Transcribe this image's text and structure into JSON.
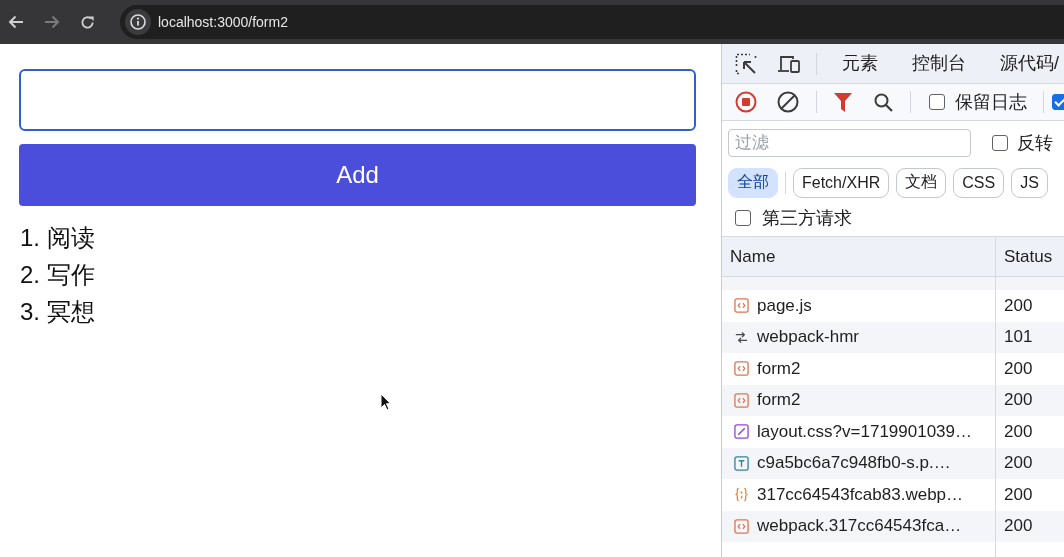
{
  "browser": {
    "url": "localhost:3000/form2"
  },
  "page": {
    "input": {
      "focused": true
    },
    "add_button": "Add",
    "items": [
      "1. 阅读",
      "2. 写作",
      "3. 冥想"
    ]
  },
  "devtools": {
    "tabs": [
      {
        "label": "元素",
        "selected": false
      },
      {
        "label": "控制台",
        "selected": false
      },
      {
        "label": "源代码/",
        "selected": false
      }
    ],
    "toolbar_checkboxes": [
      {
        "label": "保留日志",
        "checked": false
      },
      {
        "checked": true
      }
    ],
    "filter": {
      "placeholder": "过滤"
    },
    "invert": {
      "label": "反转",
      "checked": false
    },
    "type_chips": [
      {
        "label": "全部",
        "selected": true
      },
      {
        "label": "Fetch/XHR",
        "selected": false
      },
      {
        "label": "文档",
        "selected": false
      },
      {
        "label": "CSS",
        "selected": false
      },
      {
        "label": "JS",
        "selected": false
      }
    ],
    "third_party": {
      "label": "第三方请求",
      "checked": false
    },
    "table": {
      "columns": [
        "Name",
        "Status"
      ],
      "rows": [
        {
          "kind": "code",
          "name": "page.js",
          "status": "200"
        },
        {
          "kind": "websocket",
          "name": "webpack-hmr",
          "status": "101"
        },
        {
          "kind": "code",
          "name": "form2",
          "status": "200"
        },
        {
          "kind": "code",
          "name": "form2",
          "status": "200"
        },
        {
          "kind": "stylesheet",
          "name": "layout.css?v=1719901039…",
          "status": "200"
        },
        {
          "kind": "font",
          "name": "c9a5bc6a7c948fb0-s.p.…",
          "status": "200"
        },
        {
          "kind": "script",
          "name": "317cc64543fcab83.webp…",
          "status": "200"
        },
        {
          "kind": "code",
          "name": "webpack.317cc64543fca…",
          "status": "200"
        }
      ]
    }
  }
}
